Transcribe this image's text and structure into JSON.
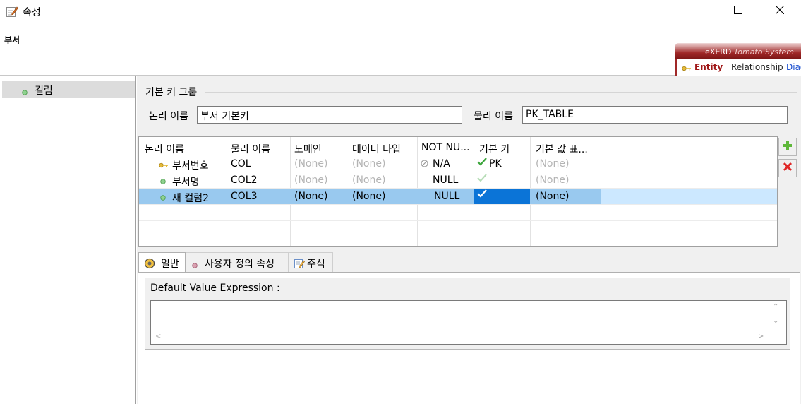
{
  "window": {
    "title": "속성",
    "icon": "edit-properties-icon",
    "controls": {
      "minimize": "minimize-icon",
      "maximize": "maximize-icon",
      "close": "close-icon"
    }
  },
  "header": {
    "title": "부서"
  },
  "banner": {
    "brand": "eXERD",
    "system": "Tomato System",
    "tabs": [
      "Entity",
      "Relationship",
      "Diag"
    ]
  },
  "sidebar": {
    "items": [
      {
        "label": "컬럼",
        "icon": "green-dot-icon"
      }
    ]
  },
  "key_group": {
    "title": "기본 키 그룹",
    "logical_label": "논리 이름",
    "logical_value": "부서 기본키",
    "physical_label": "물리 이름",
    "physical_value": "PK_TABLE"
  },
  "table": {
    "headers": [
      "논리 이름",
      "물리 이름",
      "도메인",
      "데이터 타입",
      "NOT NU...",
      "기본 키",
      "기본 값 표..."
    ],
    "rows": [
      {
        "icon": "key-icon",
        "logical": "부서번호",
        "physical": "COL",
        "domain": "(None)",
        "type": "(None)",
        "notnull": "N/A",
        "notnull_icon": "na-icon",
        "pk": "PK",
        "pk_icon": "check-icon",
        "default": "(None)"
      },
      {
        "icon": "green-dot-icon",
        "logical": "부서명",
        "physical": "COL2",
        "domain": "(None)",
        "type": "(None)",
        "notnull": "NULL",
        "pk": "",
        "pk_icon": "faded-check-icon",
        "default": "(None)"
      },
      {
        "icon": "green-dot-icon",
        "logical": "새 컬럼2",
        "physical": "COL3",
        "domain": "(None)",
        "type": "(None)",
        "notnull": "NULL",
        "pk": "",
        "pk_icon": "white-check-icon",
        "default": "(None)",
        "selected": true
      }
    ]
  },
  "buttons": {
    "add": "add-icon",
    "delete": "delete-icon"
  },
  "tabs": [
    {
      "label": "일반",
      "icon": "general-icon",
      "active": true
    },
    {
      "label": "사용자 정의 속성",
      "icon": "pink-dot-icon"
    },
    {
      "label": "주석",
      "icon": "comment-edit-icon"
    }
  ],
  "general": {
    "default_value_label": "Default Value Expression :",
    "default_value": ""
  },
  "colors": {
    "selection": "#99c9ef",
    "pk_selected": "#0b74d7",
    "brand": "#a02828"
  }
}
